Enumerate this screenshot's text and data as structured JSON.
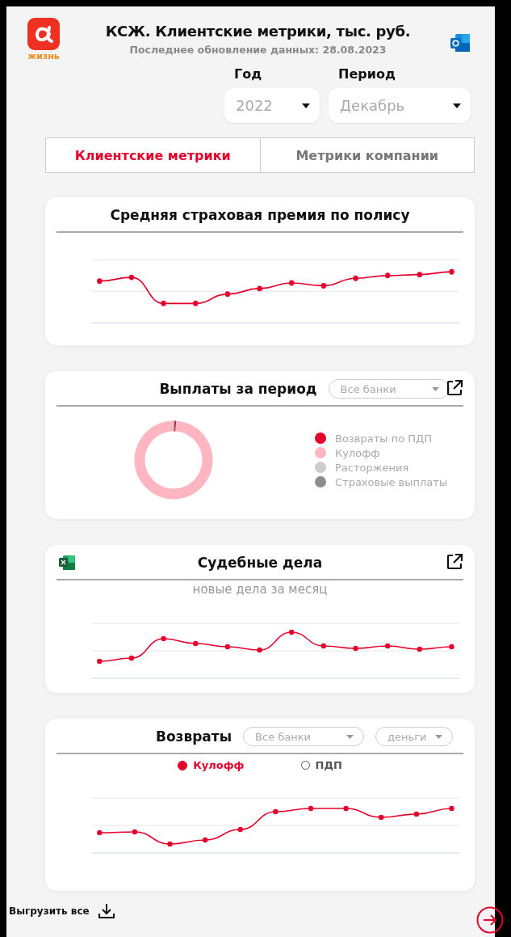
{
  "header": {
    "logo_caption": "жизнь",
    "title": "КСЖ. Клиентские метрики, тыс. руб.",
    "updated": "Последнее обновление данных: 28.08.2023"
  },
  "filters": [
    {
      "label": "Год",
      "value": "2022"
    },
    {
      "label": "Период",
      "value": "Декабрь"
    }
  ],
  "tabs": [
    {
      "label": "Клиентские метрики",
      "selected": true
    },
    {
      "label": "Метрики компании",
      "selected": false
    }
  ],
  "cards": [
    {
      "kind": "line",
      "title": "Средняя страховая премия по полису"
    },
    {
      "kind": "donut",
      "title": "Выплаты за период",
      "dropdowns": [
        "Все банки"
      ],
      "external_link": true,
      "legend": [
        {
          "label": "Возвраты по ПДП",
          "color": "#e4002b"
        },
        {
          "label": "Кулофф",
          "color": "#ffb6c1"
        },
        {
          "label": "Расторжения",
          "color": "#cccccc"
        },
        {
          "label": "Страховые выплаты",
          "color": "#8c8c8c"
        }
      ]
    },
    {
      "kind": "line",
      "title": "Судебные дела",
      "excel": true,
      "external_link": true,
      "subtitle": "новые дела за месяц"
    },
    {
      "kind": "line",
      "title": "Возвраты",
      "dropdowns": [
        "Все банки",
        "деньги"
      ],
      "toggles": [
        {
          "label": "Кулофф",
          "selected": true
        },
        {
          "label": "ПДП",
          "selected": false
        }
      ]
    }
  ],
  "footer": {
    "export_label": "Выгрузить все"
  }
}
